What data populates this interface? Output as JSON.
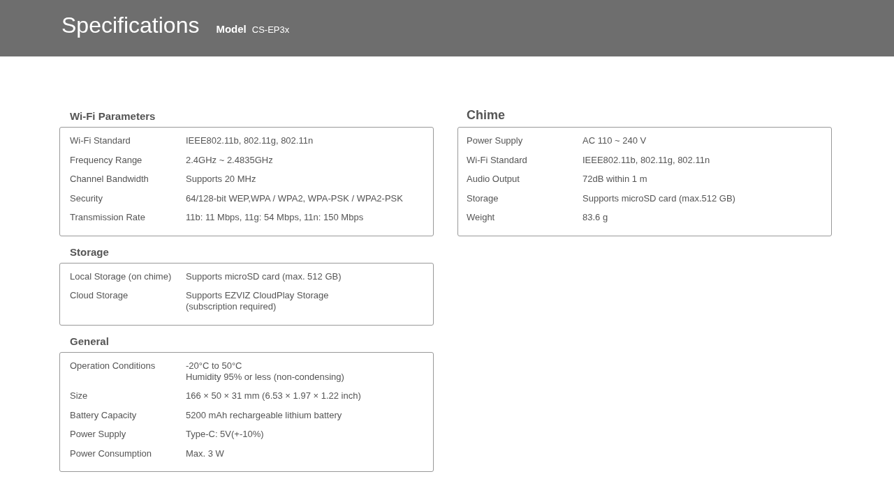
{
  "header": {
    "title": "Specifications",
    "model_label": "Model",
    "model_value": "CS-EP3x"
  },
  "columns": [
    [
      {
        "title": "Wi-Fi Parameters",
        "rows": [
          {
            "label": "Wi-Fi Standard",
            "value": [
              "IEEE802.11b, 802.11g, 802.11n"
            ]
          },
          {
            "label": "Frequency Range",
            "value": [
              "2.4GHz ~ 2.4835GHz"
            ]
          },
          {
            "label": "Channel Bandwidth",
            "value": [
              "Supports 20 MHz"
            ]
          },
          {
            "label": "Security",
            "value": [
              "64/128-bit WEP,WPA / WPA2, WPA-PSK / WPA2-PSK"
            ]
          },
          {
            "label": "Transmission Rate",
            "value": [
              "11b: 11 Mbps, 11g: 54 Mbps, 11n: 150 Mbps"
            ]
          }
        ]
      },
      {
        "title": "Storage",
        "rows": [
          {
            "label": "Local Storage (on chime)",
            "value": [
              "Supports microSD card (max. 512 GB)"
            ]
          },
          {
            "label": "Cloud Storage",
            "value": [
              "Supports EZVIZ CloudPlay Storage",
              "(subscription required)"
            ]
          }
        ]
      },
      {
        "title": "General",
        "rows": [
          {
            "label": "Operation Conditions",
            "value": [
              "-20°C to 50°C",
              "Humidity 95% or less (non-condensing)"
            ]
          },
          {
            "label": "Size",
            "value": [
              "166 × 50 × 31 mm (6.53 × 1.97 × 1.22 inch)"
            ]
          },
          {
            "label": "Battery Capacity",
            "value": [
              "5200 mAh rechargeable lithium battery"
            ]
          },
          {
            "label": "Power Supply",
            "value": [
              "Type-C: 5V(+-10%)"
            ]
          },
          {
            "label": "Power Consumption",
            "value": [
              "Max. 3 W"
            ]
          }
        ]
      }
    ],
    [
      {
        "title": "Chime",
        "rows": [
          {
            "label": "Power Supply",
            "value": [
              "AC 110 ~ 240 V"
            ]
          },
          {
            "label": "Wi-Fi Standard",
            "value": [
              "IEEE802.11b, 802.11g, 802.11n"
            ]
          },
          {
            "label": "Audio Output",
            "value": [
              "72dB within 1 m"
            ]
          },
          {
            "label": "Storage",
            "value": [
              "Supports microSD card (max.512 GB)"
            ]
          },
          {
            "label": "Weight",
            "value": [
              "83.6 g"
            ]
          }
        ]
      }
    ]
  ]
}
